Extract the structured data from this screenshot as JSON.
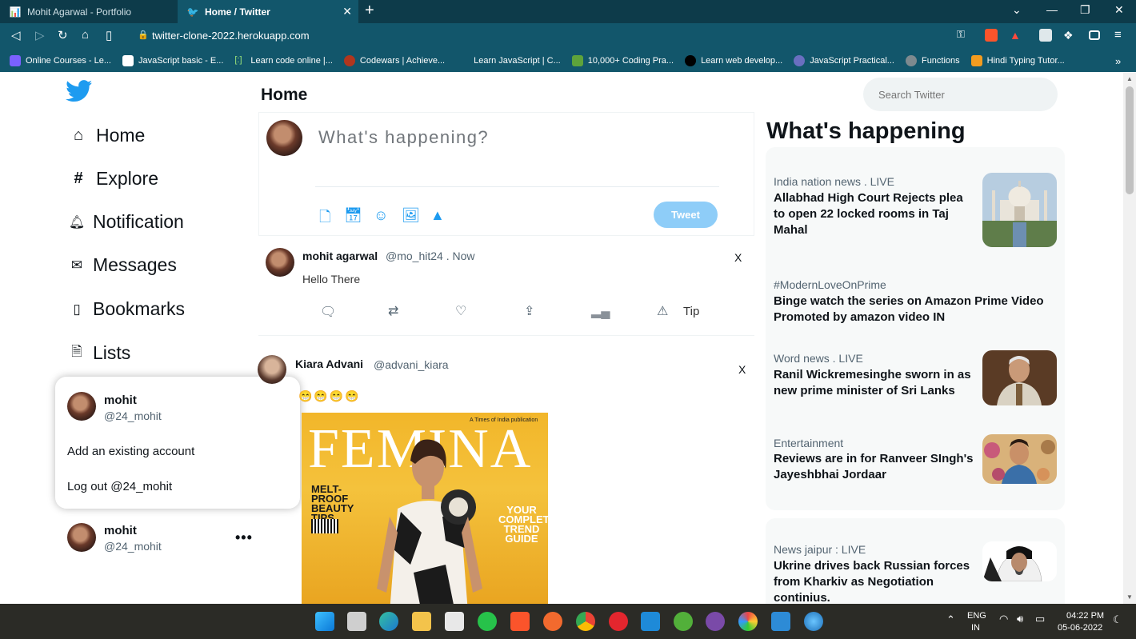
{
  "browser": {
    "tabs": [
      {
        "title": "Mohit Agarwal - Portfolio",
        "active": false
      },
      {
        "title": "Home / Twitter",
        "active": true
      }
    ],
    "tab_close": "✕",
    "new_tab": "+",
    "url": "twitter-clone-2022.herokuapp.com",
    "bookmarks": [
      "Online Courses - Le...",
      "JavaScript basic - E...",
      "Learn code online |...",
      "Codewars | Achieve...",
      "Learn JavaScript | C...",
      "10,000+ Coding Pra...",
      "Learn web develop...",
      "JavaScript Practical...",
      "Functions",
      "Hindi Typing Tutor..."
    ],
    "bookmarks_more": "»",
    "accent": "#12566b"
  },
  "sidebar": {
    "nav": [
      {
        "label": "Home",
        "icon": "home-icon"
      },
      {
        "label": "Explore",
        "icon": "hashtag-icon"
      },
      {
        "label": "Notification",
        "icon": "bell-icon"
      },
      {
        "label": "Messages",
        "icon": "mail-icon"
      },
      {
        "label": "Bookmarks",
        "icon": "bookmark-icon"
      },
      {
        "label": "Lists",
        "icon": "list-icon"
      }
    ],
    "popup": {
      "name": "mohit",
      "handle": "@24_mohit",
      "add_account": "Add an existing account",
      "logout": "Log out @24_mohit"
    },
    "account": {
      "name": "mohit",
      "handle": "@24_mohit",
      "more": "•••"
    }
  },
  "main": {
    "title": "Home",
    "compose": {
      "placeholder": "What's happening?",
      "tweet_button": "Tweet"
    },
    "tweets": [
      {
        "name": "mohit agarwal",
        "meta": "@mo_hit24 . Now",
        "text": "Hello There",
        "close": "X",
        "tip": "Tip"
      },
      {
        "name": "Kiara Advani",
        "meta": "@advani_kiara",
        "text": "😁😁😁😁",
        "close": "X",
        "magazine": {
          "title": "FEMINA",
          "tagline": "A Times of India publication",
          "left_text": "MELT-PROOF BEAUTY TIPS",
          "right_text": "YOUR COMPLETE TREND GUIDE"
        }
      }
    ]
  },
  "right": {
    "search_placeholder": "Search Twitter",
    "title": "What's happening",
    "trends": [
      {
        "category": "India nation news . LIVE",
        "headline": "Allabhad High Court Rejects plea to open 22 locked rooms in Taj Mahal"
      },
      {
        "category": "#ModernLoveOnPrime",
        "headline": "Binge watch the series on Amazon Prime Video Promoted by amazon video IN"
      },
      {
        "category": "Word news . LIVE",
        "headline": "Ranil Wickremesinghe sworn in as new prime minister of Sri Lanks"
      },
      {
        "category": "Entertainment",
        "headline": "Reviews are in for Ranveer SIngh's Jayeshbhai Jordaar"
      },
      {
        "category": "News jaipur : LIVE",
        "headline": "Ukrine drives back Russian forces from Kharkiv as Negotiation continius."
      }
    ]
  },
  "taskbar": {
    "lang": "ENG",
    "region": "IN",
    "time": "04:22 PM",
    "date": "05-06-2022"
  }
}
